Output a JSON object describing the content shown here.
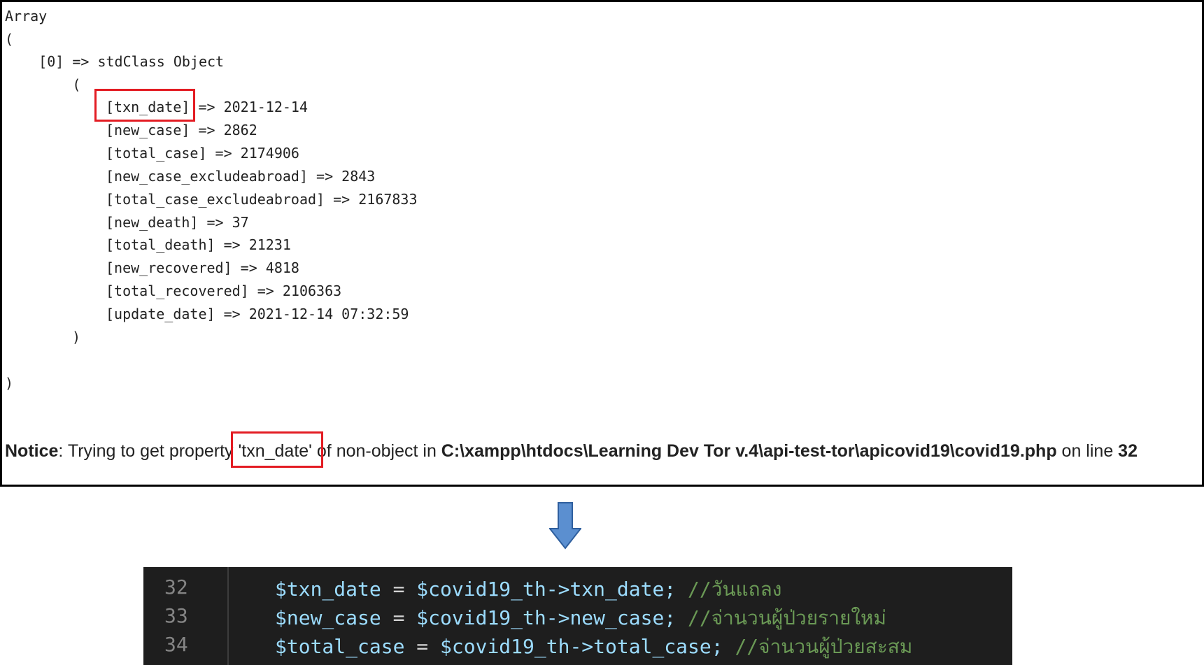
{
  "output": {
    "lines": [
      "Array",
      "(",
      "    [0] => stdClass Object",
      "        ("
    ],
    "fields": [
      "[txn_date] => 2021-12-14",
      "[new_case] => 2862",
      "[total_case] => 2174906",
      "[new_case_excludeabroad] => 2843",
      "[total_case_excludeabroad] => 2167833",
      "[new_death] => 37",
      "[total_death] => 21231",
      "[new_recovered] => 4818",
      "[total_recovered] => 2106363",
      "[update_date] => 2021-12-14 07:32:59"
    ],
    "close_inner": ")",
    "close_outer": ")"
  },
  "notice": {
    "label": "Notice",
    "text_before": ": Trying to get property ",
    "property": "'txn_date'",
    "text_mid": " of non-object in ",
    "path": "C:\\xampp\\htdocs\\Learning Dev Tor v.4\\api-test-tor\\apicovid19\\covid19.php",
    "text_after": " on line ",
    "line": "32"
  },
  "arrow": {
    "icon": "arrow-down-icon",
    "color": "#5b8fd0"
  },
  "editor": {
    "rows": [
      {
        "num": "32",
        "var": "$txn_date",
        "op": " = ",
        "expr": "$covid19_th->txn_date;",
        "comment": " //วันแถลง"
      },
      {
        "num": "33",
        "var": "$new_case",
        "op": " = ",
        "expr": "$covid19_th->new_case;",
        "comment": " //จ่านวนผู้ป่วยรายใหม่"
      },
      {
        "num": "34",
        "var": "$total_case",
        "op": " = ",
        "expr": "$covid19_th->total_case;",
        "comment": " //จ่านวนผู้ป่วยสะสม"
      }
    ]
  },
  "colors": {
    "highlight": "#e31c23",
    "editor_bg": "#1e1e1e",
    "variable": "#9cdcfe",
    "comment": "#6a9955"
  }
}
